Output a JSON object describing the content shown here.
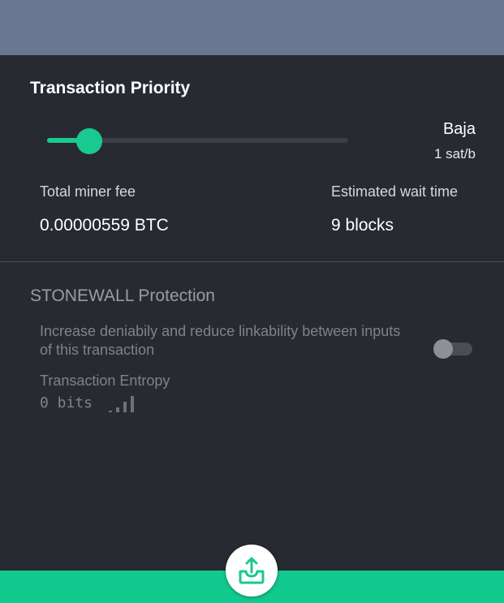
{
  "priority": {
    "title": "Transaction Priority",
    "slider_fraction": 0.14,
    "level": "Baja",
    "rate": "1 sat/b"
  },
  "fee": {
    "label": "Total miner fee",
    "value": "0.00000559 BTC"
  },
  "wait": {
    "label": "Estimated wait time",
    "value": "9 blocks"
  },
  "stonewall": {
    "title": "STONEWALL Protection",
    "description": "Increase deniabily and reduce linkability between inputs of this transaction",
    "enabled": false
  },
  "entropy": {
    "label": "Transaction Entropy",
    "value": "0 bits"
  },
  "colors": {
    "accent": "#19c990",
    "background": "#272a31",
    "top_bar": "#6b7690"
  },
  "icons": {
    "signal": "signal-strength-icon",
    "send": "send-inbox-upload-icon"
  }
}
